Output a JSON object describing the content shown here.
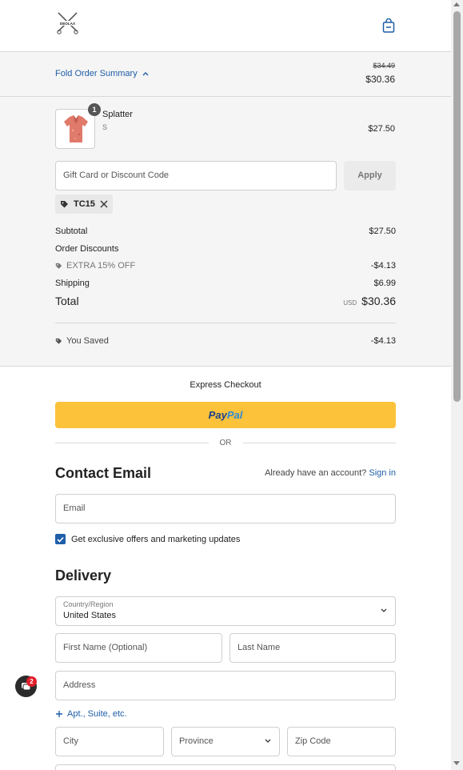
{
  "header": {
    "logo_text": "DEOLAX"
  },
  "summary": {
    "fold_label": "Fold Order Summary",
    "price_old": "$34.49",
    "price_new": "$30.36"
  },
  "product": {
    "quantity": "1",
    "name": "Splatter",
    "variant": "S",
    "price": "$27.50"
  },
  "discount": {
    "placeholder": "Gift Card or Discount Code",
    "apply_label": "Apply",
    "code": "TC15"
  },
  "totals": {
    "subtotal_label": "Subtotal",
    "subtotal_value": "$27.50",
    "order_discounts_label": "Order Discounts",
    "discount_name": "EXTRA 15% OFF",
    "discount_value": "-$4.13",
    "shipping_label": "Shipping",
    "shipping_value": "$6.99",
    "total_label": "Total",
    "currency": "USD",
    "total_value": "$30.36",
    "saved_label": "You Saved",
    "saved_value": "-$4.13"
  },
  "express": {
    "label": "Express Checkout",
    "paypal_pay": "Pay",
    "paypal_pal": "Pal",
    "or_label": "OR"
  },
  "contact": {
    "title": "Contact Email",
    "account_prompt": "Already have an account?",
    "sign_in": "Sign in",
    "email_placeholder": "Email",
    "marketing_label": "Get exclusive offers and marketing updates",
    "marketing_checked": true
  },
  "delivery": {
    "title": "Delivery",
    "country_label": "Country/Region",
    "country_value": "United States",
    "first_name_placeholder": "First Name (Optional)",
    "last_name_placeholder": "Last Name",
    "address_placeholder": "Address",
    "apt_link": "Apt., Suite, etc.",
    "city_placeholder": "City",
    "province_placeholder": "Province",
    "zip_placeholder": "Zip Code"
  },
  "chat": {
    "badge_count": "2"
  },
  "colors": {
    "accent_blue": "#1f5ea8",
    "paypal_yellow": "#fcc23a",
    "summary_bg": "#f5f5f5",
    "badge_red": "#e11d2a"
  }
}
